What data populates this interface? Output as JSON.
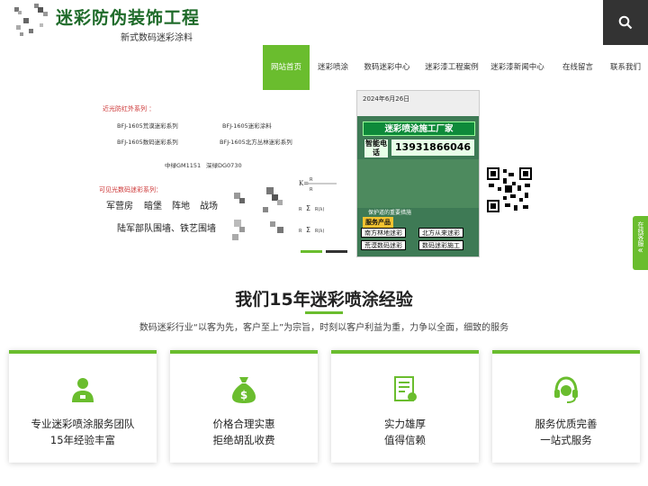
{
  "header": {
    "title": "迷彩防伪装饰工程",
    "subtitle": "新式数码迷彩涂料",
    "search_icon": "search-icon"
  },
  "nav": {
    "items": [
      {
        "label": "网站首页",
        "active": true
      },
      {
        "label": "迷彩喷涂"
      },
      {
        "label": "数码迷彩中心"
      },
      {
        "label": "迷彩漆工程案例"
      },
      {
        "label": "迷彩漆新闻中心"
      },
      {
        "label": "在线留言"
      },
      {
        "label": "联系我们"
      }
    ]
  },
  "banner": {
    "infrared_title": "近光防红外系列 ：",
    "infrared_items": [
      "BFJ-1605荒漠迷彩系列",
      "BFJ-1605迷彩涂料",
      "BFJ-1605数码迷彩系列",
      "BFJ-1605北方丛林迷彩系列"
    ],
    "colors": [
      "中绿GM1151",
      "深绿DG0730"
    ],
    "visible_title": "可见光数码迷彩系列：",
    "targets_row1": [
      "军营房",
      "暗堡",
      "阵地",
      "战场"
    ],
    "targets_row2": "陆军部队围墙、铁艺围墙",
    "phone": {
      "date": "2024年6月26日",
      "title": "迷彩喷涂施工厂家",
      "tel_label": "智能电话",
      "tel": "13931866046",
      "watermark": "保护道的重要措施",
      "service_label": "服务产品",
      "tags": [
        "南方林地迷彩",
        "北方从来迷彩",
        "荒漠数码迷彩",
        "数码迷彩施工"
      ]
    }
  },
  "side_float": {
    "label": "在线客服",
    "icon": "chevron-left-icon"
  },
  "section": {
    "title": "我们15年迷彩喷涂经验",
    "description": "数码迷彩行业“以客为先，客户至上”为宗旨，时刻以客户利益为重，力争以全面，细致的服务"
  },
  "cards": [
    {
      "icon": "service-person-icon",
      "line1": "专业迷彩喷涂服务团队",
      "line2": "15年经验丰富"
    },
    {
      "icon": "money-bag-icon",
      "line1": "价格合理实惠",
      "line2": "拒绝胡乱收费"
    },
    {
      "icon": "document-icon",
      "line1": "实力雄厚",
      "line2": "值得信赖"
    },
    {
      "icon": "headset-icon",
      "line1": "服务优质完善",
      "line2": "一站式服务"
    }
  ],
  "colors": {
    "accent": "#6abd2e",
    "brand": "#1f6b2a",
    "dark": "#333333"
  }
}
